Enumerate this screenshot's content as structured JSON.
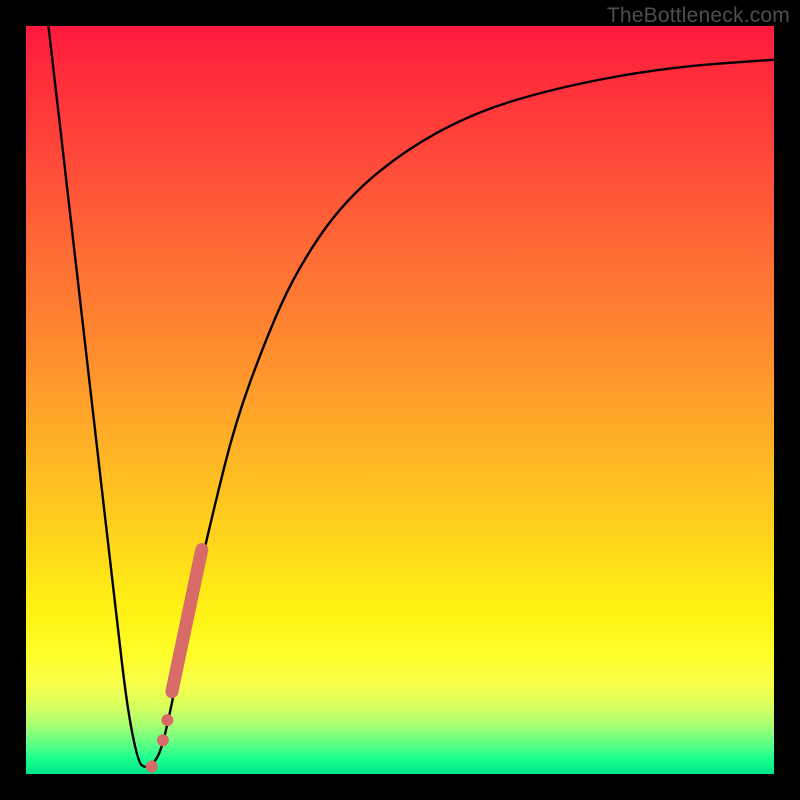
{
  "watermark": "TheBottleneck.com",
  "colors": {
    "frame": "#000000",
    "curve": "#000000",
    "dots": "#d86a67",
    "gradient_top": "#ff1a3f",
    "gradient_bottom": "#00e589"
  },
  "chart_data": {
    "type": "line",
    "title": "",
    "xlabel": "",
    "ylabel": "",
    "xlim": [
      0,
      100
    ],
    "ylim": [
      0,
      100
    ],
    "annotations": [
      "TheBottleneck.com"
    ],
    "series": [
      {
        "name": "bottleneck-curve",
        "x": [
          3,
          6,
          9,
          12,
          13.5,
          15,
          16,
          17,
          18,
          19,
          20,
          22,
          25,
          28,
          32,
          36,
          42,
          50,
          60,
          72,
          86,
          100
        ],
        "y": [
          100,
          74,
          48,
          22,
          9,
          1.5,
          0.8,
          1.3,
          3.0,
          7,
          12,
          22,
          35,
          47,
          58,
          67,
          76,
          83,
          88.5,
          92,
          94.5,
          95.5
        ]
      }
    ],
    "markers": [
      {
        "name": "thick-segment",
        "x_range": [
          19.5,
          23.5
        ],
        "y_range": [
          11,
          30
        ],
        "style": "thick-pink-line"
      },
      {
        "name": "dot-1",
        "x": 18.3,
        "y": 4.5
      },
      {
        "name": "dot-2",
        "x": 18.9,
        "y": 7.2
      },
      {
        "name": "dot-3",
        "x": 16.8,
        "y": 1.0
      }
    ]
  }
}
